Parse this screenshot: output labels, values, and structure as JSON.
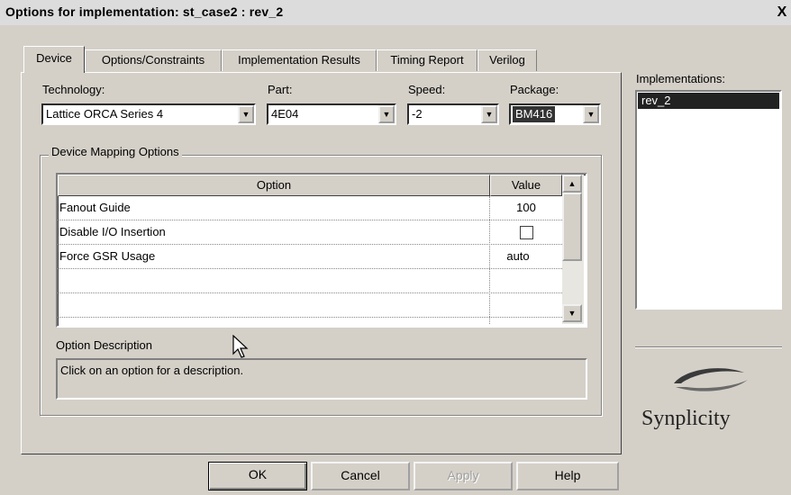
{
  "window": {
    "title": "Options for implementation: st_case2 : rev_2",
    "close_glyph": "X"
  },
  "tabs": [
    {
      "label": "Device",
      "active": true
    },
    {
      "label": "Options/Constraints"
    },
    {
      "label": "Implementation Results"
    },
    {
      "label": "Timing Report"
    },
    {
      "label": "Verilog"
    }
  ],
  "device": {
    "technology": {
      "label": "Technology:",
      "value": "Lattice ORCA Series 4"
    },
    "part": {
      "label": "Part:",
      "value": "4E04"
    },
    "speed": {
      "label": "Speed:",
      "value": "-2"
    },
    "package": {
      "label": "Package:",
      "value": "BM416"
    }
  },
  "mapping": {
    "group_title": "Device Mapping Options",
    "columns": {
      "option": "Option",
      "value": "Value"
    },
    "rows": [
      {
        "option": "Fanout Guide",
        "value": "100"
      },
      {
        "option": "Disable I/O Insertion",
        "value": "",
        "checkbox": true,
        "checked": false
      },
      {
        "option": "Force GSR Usage",
        "value": "auto"
      }
    ],
    "description_label": "Option Description",
    "description_text": "Click on an option for a description."
  },
  "implementations": {
    "label": "Implementations:",
    "items": [
      "rev_2"
    ]
  },
  "logo": {
    "text": "Synplicity"
  },
  "buttons": {
    "ok": "OK",
    "cancel": "Cancel",
    "apply": "Apply",
    "help": "Help"
  },
  "icons": {
    "dropdown": "chevron-down-icon",
    "scroll_up": "arrow-up-icon",
    "scroll_down": "arrow-down-icon",
    "cursor": "mouse-pointer-icon",
    "logo": "synplicity-swoosh-icon"
  },
  "colors": {
    "dialog_bg": "#d4d0c8",
    "selection_bg": "#222222",
    "selection_fg": "#ffffff"
  }
}
